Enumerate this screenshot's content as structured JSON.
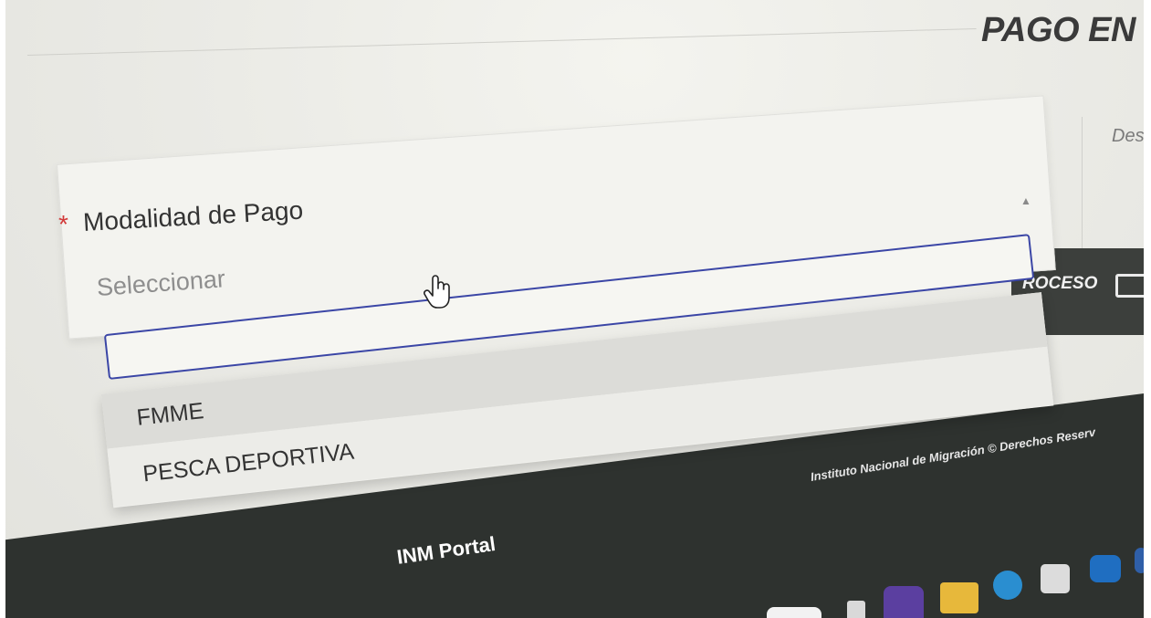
{
  "header": {
    "title": "PAGO EN L",
    "desc_label": "Des"
  },
  "form": {
    "required_mark": "*",
    "field_label": "Modalidad de Pago",
    "select_placeholder": "Seleccionar",
    "search_value": "",
    "options": [
      {
        "label": "FMME"
      },
      {
        "label": "PESCA DEPORTIVA"
      }
    ]
  },
  "side": {
    "process_label": "ROCESO"
  },
  "footer": {
    "copyright": "Instituto Nacional de Migración © Derechos Reserv",
    "portal_name": "INM Portal"
  },
  "icons": [
    "chevron-up-icon",
    "document-icon",
    "hand-cursor-icon",
    "teams-icon",
    "folder-icon",
    "edge-icon",
    "store-icon",
    "outlook-icon"
  ]
}
